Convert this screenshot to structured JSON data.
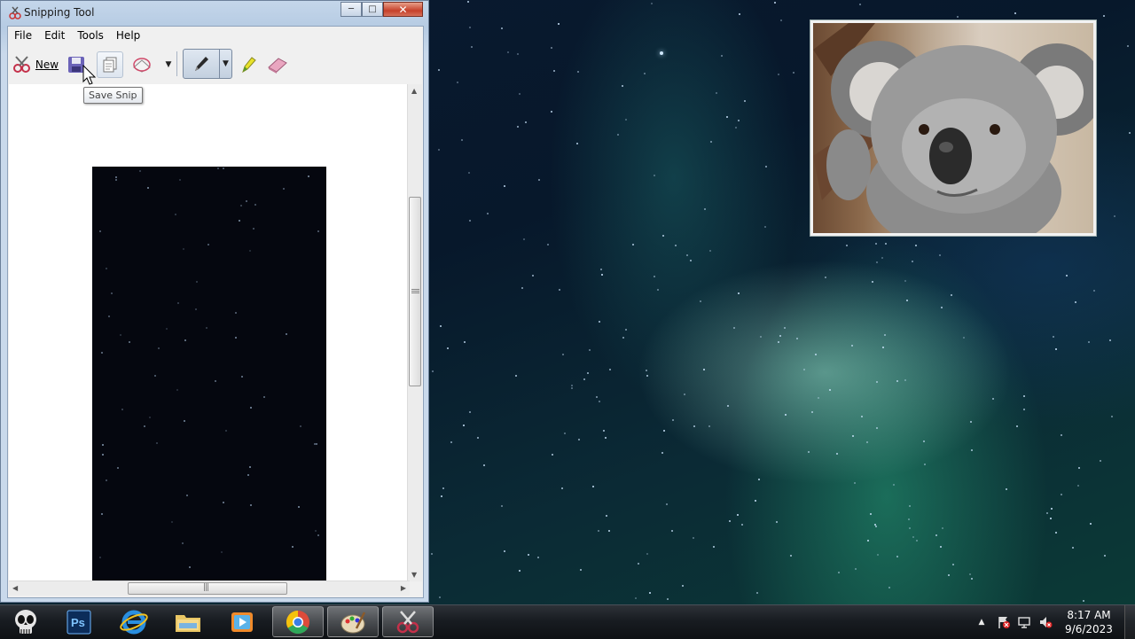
{
  "window": {
    "title": "Snipping Tool",
    "caption_buttons": {
      "minimize": "minimize",
      "maximize": "maximize",
      "close": "close"
    }
  },
  "menu": [
    "File",
    "Edit",
    "Tools",
    "Help"
  ],
  "toolbar": {
    "new_label": "New",
    "save_tooltip": "Save Snip"
  },
  "icons": {
    "new": "scissors-icon",
    "save": "floppy-disk-icon",
    "copy": "copy-icon",
    "send": "send-snip-icon",
    "pen": "pen-icon",
    "highlighter": "highlighter-icon",
    "eraser": "eraser-icon"
  },
  "taskbar": {
    "apps": [
      "skull-start-icon",
      "photoshop-icon",
      "internet-explorer-icon",
      "file-explorer-icon",
      "media-player-icon",
      "chrome-icon",
      "paint-icon",
      "snipping-tool-icon"
    ],
    "clock_time": "8:17 AM",
    "clock_date": "9/6/2023"
  },
  "colors": {
    "accent": "#3d8fd0",
    "close_button": "#c6402a",
    "snip_background": "#05070f"
  }
}
